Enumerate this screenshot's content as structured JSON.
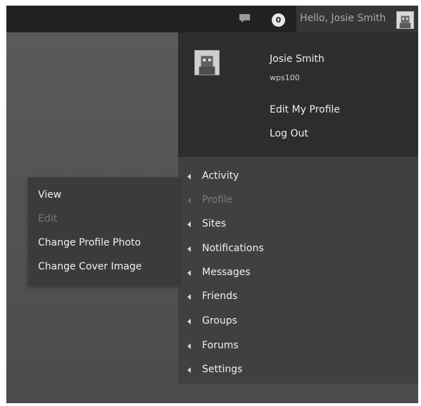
{
  "adminbar": {
    "comments_icon": "comment-bubble-icon",
    "notification_count": "0",
    "greeting": "Hello, Josie Smith",
    "avatar_icon": "user-avatar-icon"
  },
  "account": {
    "avatar_icon": "user-avatar-icon",
    "display_name": "Josie Smith",
    "username": "wps100",
    "edit_profile": "Edit My Profile",
    "log_out": "Log Out"
  },
  "nav": {
    "items": [
      {
        "label": "Activity"
      },
      {
        "label": "Profile"
      },
      {
        "label": "Sites"
      },
      {
        "label": "Notifications"
      },
      {
        "label": "Messages"
      },
      {
        "label": "Friends"
      },
      {
        "label": "Groups"
      },
      {
        "label": "Forums"
      },
      {
        "label": "Settings"
      }
    ]
  },
  "profile_submenu": {
    "items": [
      {
        "label": "View"
      },
      {
        "label": "Edit"
      },
      {
        "label": "Change Profile Photo"
      },
      {
        "label": "Change Cover Image"
      }
    ]
  },
  "colors": {
    "adminbar_bg": "#222222",
    "panel_bg": "#2d2d2d",
    "menu_bg": "#404040",
    "disabled_text": "#777777"
  }
}
